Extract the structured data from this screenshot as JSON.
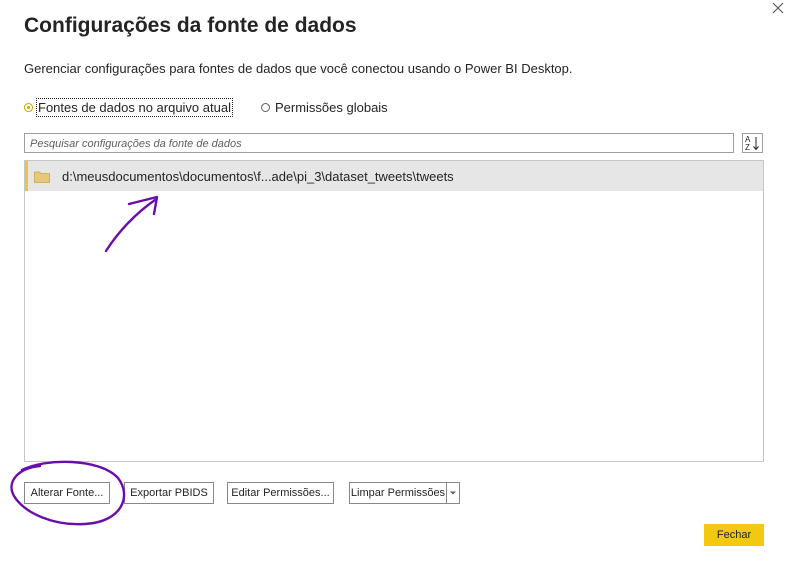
{
  "dialog": {
    "title": "Configurações da fonte de dados",
    "description": "Gerenciar configurações para fontes de dados que você conectou usando o Power BI Desktop."
  },
  "scope": {
    "options": [
      {
        "label": "Fontes de dados no arquivo atual",
        "selected": true
      },
      {
        "label": "Permissões globais",
        "selected": false
      }
    ]
  },
  "search": {
    "placeholder": "Pesquisar configurações da fonte de dados",
    "value": ""
  },
  "sort": {
    "icon": "sort-az-icon",
    "glyph_top": "A",
    "glyph_bottom": "Z"
  },
  "sources": [
    {
      "icon": "folder-icon",
      "path": "d:\\meusdocumentos\\documentos\\f...ade\\pi_3\\dataset_tweets\\tweets",
      "selected": true
    }
  ],
  "actions": {
    "change_source": "Alterar Fonte...",
    "export_pbids": "Exportar PBIDS",
    "edit_permissions": "Editar Permissões...",
    "clear_permissions": "Limpar Permissões",
    "close": "Fechar"
  },
  "colors": {
    "accent": "#f2c811",
    "selection_bar": "#e8c547",
    "row_selected": "#e6e6e6",
    "annotation": "#6a0dad",
    "folder": "#e8c77a"
  }
}
